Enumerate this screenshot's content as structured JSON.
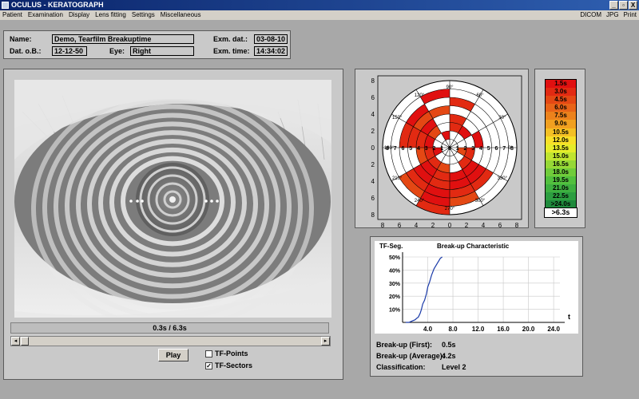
{
  "window": {
    "title": "OCULUS - KERATOGRAPH",
    "buttons": [
      "_",
      "▫",
      "X"
    ]
  },
  "menu": {
    "left": [
      "Patient",
      "Examination",
      "Display",
      "Lens fitting",
      "Settings",
      "Miscellaneous"
    ],
    "right": [
      "DICOM",
      "JPG",
      "Print"
    ]
  },
  "patient": {
    "name_label": "Name:",
    "name": "Demo, Tearfilm Breakuptime",
    "dob_label": "Dat. o.B.:",
    "dob": "12-12-50",
    "eye_label": "Eye:",
    "eye": "Right",
    "exam_date_label": "Exm. dat.:",
    "exam_date": "03-08-10",
    "exam_time_label": "Exm. time:",
    "exam_time": "14:34:02"
  },
  "playback": {
    "time": "0.3s /  6.3s",
    "play_label": "Play",
    "tf_points_label": "TF-Points",
    "tf_points_checked": false,
    "tf_sectors_label": "TF-Sectors",
    "tf_sectors_checked": true
  },
  "polar": {
    "axis_ticks": [
      "8",
      "6",
      "4",
      "2",
      "0",
      "2",
      "4",
      "6",
      "8"
    ],
    "inner_ticks": [
      "8",
      "7",
      "6",
      "5",
      "4",
      "3",
      "2",
      "1",
      "0",
      "1",
      "2",
      "3",
      "4",
      "5",
      "6",
      "7",
      "8"
    ],
    "angles": [
      "0°",
      "30°",
      "60°",
      "90°",
      "120°",
      "150°",
      "180°",
      "210°",
      "240°",
      "270°",
      "300°",
      "330°"
    ]
  },
  "legend": {
    "entries": [
      "1.5s",
      "3.0s",
      "4.5s",
      "6.0s",
      "7.5s",
      "9.0s",
      "10.5s",
      "12.0s",
      "13.5s",
      "15.0s",
      "16.5s",
      "18.0s",
      "19.5s",
      "21.0s",
      "22.5s",
      ">24.0s"
    ],
    "colors": [
      "#e01010",
      "#e22a12",
      "#e44814",
      "#e86418",
      "#ec821c",
      "#f0a020",
      "#f4c024",
      "#f8e028",
      "#e6ec2a",
      "#c0e430",
      "#96d836",
      "#70cc3a",
      "#52c03e",
      "#3eb040",
      "#2c9e40",
      "#1f8a3c"
    ],
    "current": ">6.3s"
  },
  "breakup_chart": {
    "title": "Break-up Characteristic",
    "y_axis_label": "TF-Seg.",
    "x_axis_label": "t",
    "y_ticks": [
      "50%",
      "40%",
      "30%",
      "20%",
      "10%"
    ],
    "x_ticks": [
      "4.0",
      "8.0",
      "12.0",
      "16.0",
      "20.0",
      "24.0"
    ],
    "chart_data": {
      "type": "line",
      "title": "Break-up Characteristic",
      "xlabel": "t",
      "ylabel": "TF-Seg.",
      "xlim": [
        0,
        25
      ],
      "ylim": [
        0,
        50
      ],
      "x": [
        0.5,
        1.0,
        1.5,
        2.0,
        2.2,
        2.5,
        2.8,
        3.0,
        3.2,
        3.5,
        3.8,
        4.0,
        4.3,
        4.6,
        5.0,
        5.5,
        6.0,
        6.3
      ],
      "y": [
        0,
        0,
        1,
        2,
        3,
        4,
        7,
        10,
        14,
        17,
        22,
        27,
        31,
        36,
        41,
        45,
        49,
        50
      ]
    }
  },
  "stats": {
    "first_label": "Break-up (First):",
    "first": "0.5s",
    "avg_label": "Break-up (Average):",
    "avg": "4.2s",
    "class_label": "Classification:",
    "class": "Level 2"
  }
}
